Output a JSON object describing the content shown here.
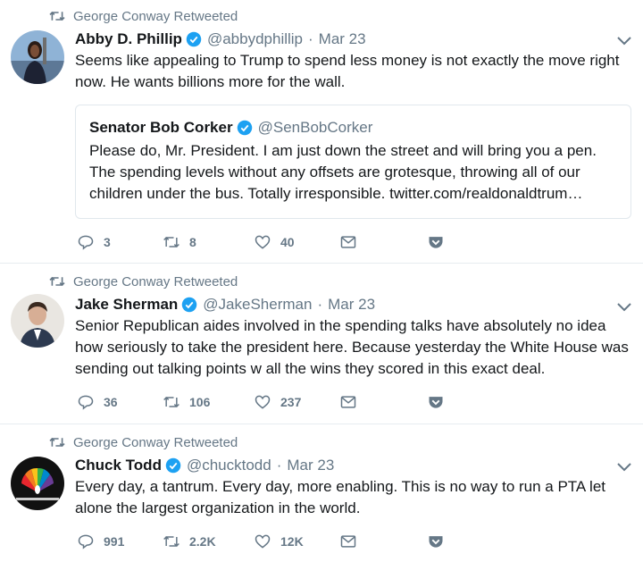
{
  "tweets": [
    {
      "context": "George Conway Retweeted",
      "name": "Abby D. Phillip",
      "handle": "@abbydphillip",
      "separator": "·",
      "time": "Mar 23",
      "text": "Seems like appealing to Trump to spend less money is not exactly the move right now. He wants billions more for the wall.",
      "quote": {
        "name": "Senator Bob Corker",
        "handle": "@SenBobCorker",
        "text": "Please do, Mr. President. I am just down the street and will bring you a pen. The spending levels without any offsets are grotesque, throwing all of our children under the bus. Totally irresponsible. twitter.com/realdonaldtrum…"
      },
      "replies": "3",
      "retweets": "8",
      "likes": "40"
    },
    {
      "context": "George Conway Retweeted",
      "name": "Jake Sherman",
      "handle": "@JakeSherman",
      "separator": "·",
      "time": "Mar 23",
      "text": "Senior Republican aides involved in the spending talks have absolutely no idea how seriously to take the president here. Because yesterday the White House was sending out talking points w all the wins they scored in this exact deal.",
      "replies": "36",
      "retweets": "106",
      "likes": "237"
    },
    {
      "context": "George Conway Retweeted",
      "name": "Chuck Todd",
      "handle": "@chucktodd",
      "separator": "·",
      "time": "Mar 23",
      "text": "Every day, a tantrum.  Every day, more enabling.  This is no way to run a PTA let alone the largest organization in the world.",
      "replies": "991",
      "retweets": "2.2K",
      "likes": "12K"
    }
  ],
  "colors": {
    "text": "#14171a",
    "secondary": "#657786",
    "verified": "#1da1f2",
    "border": "#e6ecf0"
  },
  "icons": [
    "retweet-icon",
    "verified-badge-icon",
    "caret-down-icon",
    "reply-icon",
    "like-icon",
    "direct-message-icon",
    "pocket-icon"
  ]
}
